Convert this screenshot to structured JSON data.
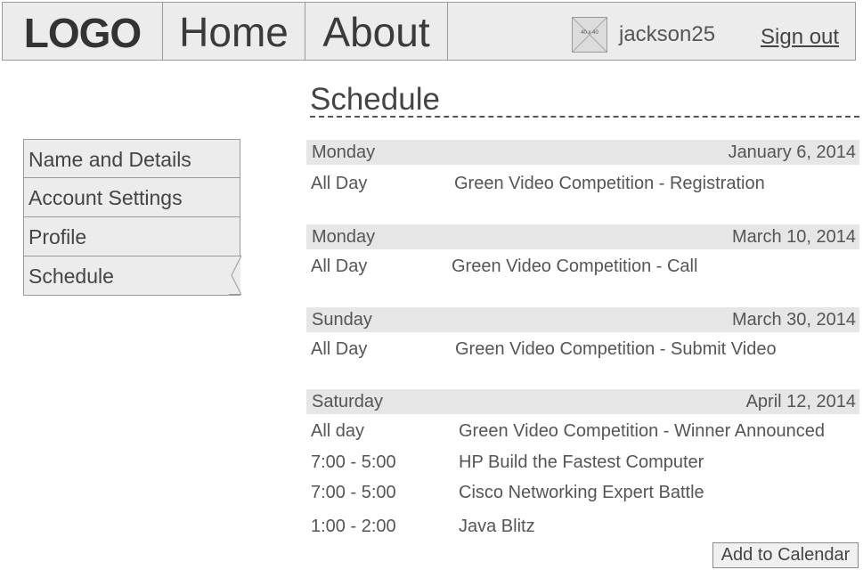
{
  "header": {
    "logo": "LOGO",
    "nav": [
      "Home",
      "About"
    ],
    "avatar_label": "40 x 40",
    "username": "jackson25",
    "signout": "Sign out"
  },
  "sidebar": {
    "items": [
      {
        "label": "Name and Details"
      },
      {
        "label": "Account Settings"
      },
      {
        "label": "Profile"
      },
      {
        "label": "Schedule",
        "active": true
      }
    ]
  },
  "main": {
    "title": "Schedule",
    "days": [
      {
        "day": "Monday",
        "date": "January 6, 2014",
        "events": [
          {
            "time": "All Day",
            "title": "Green Video Competition - Registration"
          }
        ]
      },
      {
        "day": "Monday",
        "date": "March 10, 2014",
        "events": [
          {
            "time": "All Day",
            "title": "Green Video Competition - Call"
          }
        ]
      },
      {
        "day": "Sunday",
        "date": "March 30, 2014",
        "events": [
          {
            "time": "All Day",
            "title": "Green Video Competition - Submit Video"
          }
        ]
      },
      {
        "day": "Saturday",
        "date": "April 12, 2014",
        "events": [
          {
            "time": "All day",
            "title": "Green Video Competition - Winner Announced"
          },
          {
            "time": "7:00 - 5:00",
            "title": "HP Build the Fastest Computer"
          },
          {
            "time": "7:00 - 5:00",
            "title": "Cisco Networking Expert Battle"
          },
          {
            "time": "1:00 - 2:00",
            "title": "Java Blitz"
          }
        ]
      }
    ],
    "add_to_calendar": "Add to Calendar"
  }
}
